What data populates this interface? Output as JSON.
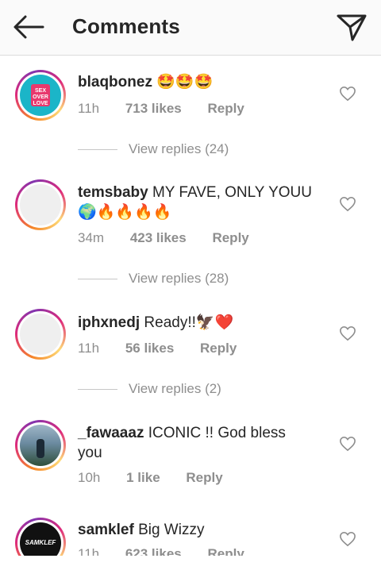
{
  "header": {
    "title": "Comments",
    "back_icon": "arrow-left-icon",
    "send_icon": "paper-plane-icon"
  },
  "comments": [
    {
      "username": "blaqbonez",
      "text": "🤩🤩🤩",
      "time": "11h",
      "likes": "713 likes",
      "reply": "Reply",
      "avatar_text": "SEX OVER LOVE",
      "view_replies": "View replies (24)"
    },
    {
      "username": "temsbaby",
      "text": "MY FAVE, ONLY YOUU",
      "text_line2": "🌍🔥🔥🔥🔥",
      "time": "34m",
      "likes": "423 likes",
      "reply": "Reply",
      "view_replies": "View replies (28)"
    },
    {
      "username": "iphxnedj",
      "text": "Ready!!🦅❤️",
      "time": "11h",
      "likes": "56 likes",
      "reply": "Reply",
      "view_replies": "View replies (2)"
    },
    {
      "username": "_fawaaaz",
      "text": "ICONIC !! God bless",
      "text_line2": "you",
      "time": "10h",
      "likes": "1 like",
      "reply": "Reply"
    },
    {
      "username": "samklef",
      "text": "Big Wizzy",
      "time": "11h",
      "likes": "623 likes",
      "reply": "Reply",
      "avatar_text": "SAMKLEF"
    }
  ],
  "colors": {
    "accent_ring": "#dd2a7b",
    "text_primary": "#262626",
    "text_secondary": "#8e8e8e"
  }
}
